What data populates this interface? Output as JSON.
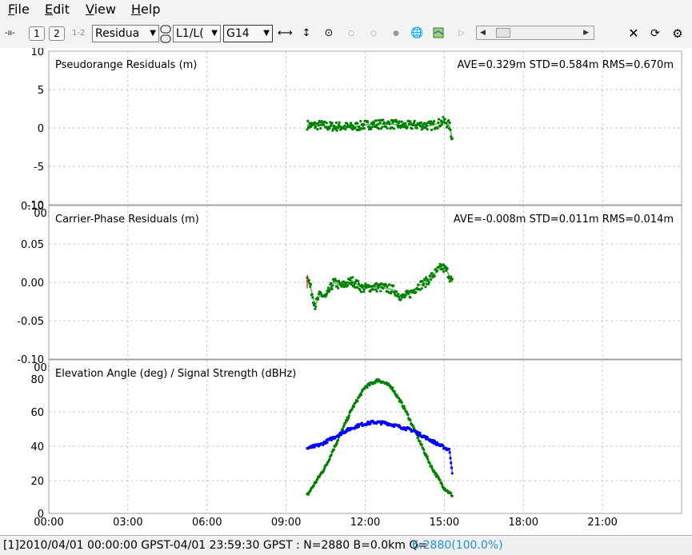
{
  "menu": {
    "file": "File",
    "edit": "Edit",
    "view": "View",
    "help": "Help"
  },
  "toolbar": {
    "toggle_glyph": "-ıı-",
    "frame1": "1",
    "frame2": "2",
    "frame12": "1-2",
    "plot_type": "Residua",
    "freq": "L1/L(",
    "satellite": "G14"
  },
  "status": {
    "main": "[1]2010/04/01 00:00:00 GPST-04/01 23:59:30 GPST : N=2880 B=0.0km Q=",
    "quality": "6:2880(100.0%)"
  },
  "colors": {
    "series_green": "#008000",
    "series_blue": "#0000ff",
    "outlier_red": "#ff0000",
    "status_quality": "#1e90d6"
  },
  "chart_data": [
    {
      "type": "scatter",
      "title": "Pseudorange Residuals (m)",
      "stats": "AVE=0.329m STD=0.584m RMS=0.670m",
      "ylim": [
        -10,
        10
      ],
      "yticks": [
        "10",
        "5",
        "0",
        "-5",
        "-10"
      ],
      "xlim_hours": [
        0,
        24
      ],
      "xticks": [
        "00:00",
        "03:00",
        "06:00",
        "09:00",
        "12:00",
        "15:00",
        "18:00",
        "21:00"
      ],
      "series": [
        {
          "x_hours": [
            9.8,
            10.0,
            10.3,
            10.6,
            11.0,
            11.5,
            12.0,
            12.5,
            13.0,
            13.5,
            14.0,
            14.5,
            14.8,
            15.0,
            15.2,
            15.3
          ],
          "y": [
            0.4,
            0.3,
            0.4,
            0.2,
            0.2,
            0.1,
            0.4,
            0.5,
            0.5,
            0.3,
            0.4,
            0.3,
            0.6,
            0.9,
            0.3,
            -1.5
          ]
        }
      ]
    },
    {
      "type": "scatter",
      "title": "Carrier-Phase Residuals (m)",
      "stats": "AVE=-0.008m STD=0.011m RMS=0.014m",
      "ylim": [
        -0.1,
        0.1
      ],
      "yticks": [
        "0.10",
        "0.05",
        "0.00",
        "-0.05",
        "-0.10"
      ],
      "xlim_hours": [
        0,
        24
      ],
      "xticks": [
        "00:00",
        "03:00",
        "06:00",
        "09:00",
        "12:00",
        "15:00",
        "18:00",
        "21:00"
      ],
      "series": [
        {
          "x_hours": [
            9.8,
            9.95,
            10.1,
            10.3,
            10.5,
            10.8,
            11.1,
            11.5,
            11.9,
            12.3,
            12.7,
            13.1,
            13.4,
            13.7,
            14.0,
            14.3,
            14.6,
            14.9,
            15.1,
            15.3
          ],
          "y": [
            0.01,
            -0.01,
            -0.03,
            -0.015,
            -0.02,
            0.0,
            -0.005,
            0.002,
            -0.008,
            -0.006,
            -0.007,
            -0.01,
            -0.02,
            -0.015,
            -0.005,
            0.0,
            0.01,
            0.02,
            0.015,
            0.0
          ]
        }
      ]
    },
    {
      "type": "scatter",
      "title": "Elevation Angle (deg) / Signal Strength (dBHz)",
      "ylim": [
        0,
        85
      ],
      "yticks": [
        "80",
        "60",
        "40",
        "20",
        "0"
      ],
      "xlim_hours": [
        0,
        24
      ],
      "xticks": [
        "00:00",
        "03:00",
        "06:00",
        "09:00",
        "12:00",
        "15:00",
        "18:00",
        "21:00"
      ],
      "series": [
        {
          "x_hours": [
            9.8,
            10.5,
            11.0,
            11.5,
            12.0,
            12.5,
            13.0,
            13.5,
            14.0,
            14.5,
            15.0,
            15.3
          ],
          "y": [
            10,
            26,
            42,
            58,
            70,
            74,
            70,
            58,
            42,
            26,
            14,
            10
          ]
        },
        {
          "x_hours": [
            9.8,
            10.3,
            10.8,
            11.3,
            11.8,
            12.3,
            12.8,
            13.3,
            13.8,
            14.3,
            14.8,
            15.2,
            15.3
          ],
          "y": [
            36,
            38,
            42,
            46,
            49,
            50.5,
            50,
            48,
            46,
            42,
            38,
            35,
            23
          ]
        }
      ]
    }
  ]
}
